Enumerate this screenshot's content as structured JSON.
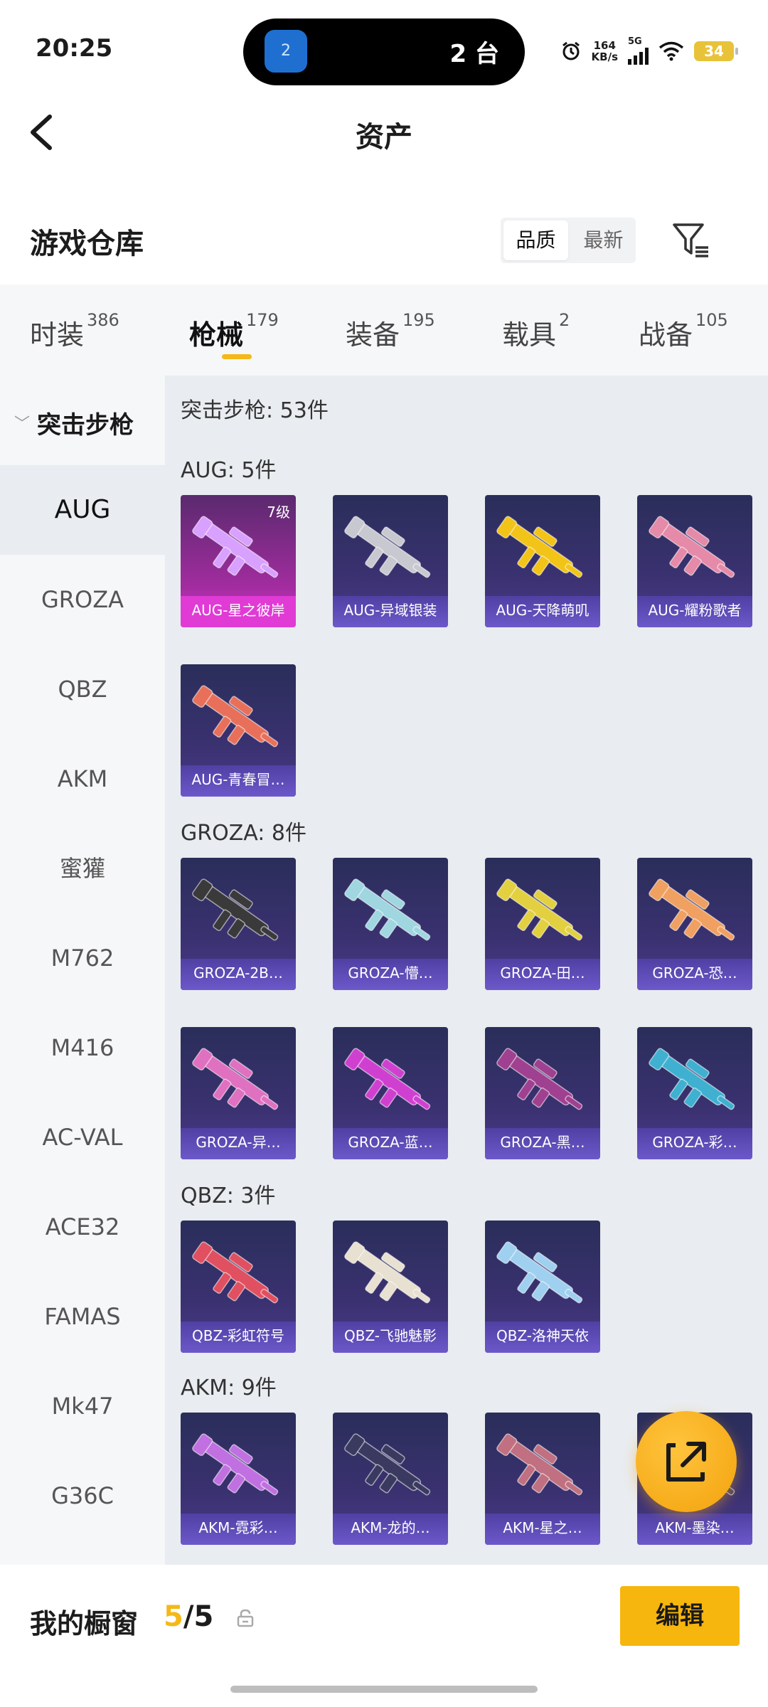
{
  "status_bar": {
    "time": "20:25",
    "island_badge": "2",
    "island_text": "2 台",
    "net_speed_value": "164",
    "net_speed_unit": "KB/s",
    "network": "5G",
    "battery": "34"
  },
  "header": {
    "title": "资产"
  },
  "warehouse": {
    "title": "游戏仓库",
    "sort_options": [
      "品质",
      "最新"
    ],
    "sort_selected": "品质"
  },
  "tabs": [
    {
      "label": "时装",
      "count": "386"
    },
    {
      "label": "枪械",
      "count": "179",
      "active": true
    },
    {
      "label": "装备",
      "count": "195"
    },
    {
      "label": "载具",
      "count": "2"
    },
    {
      "label": "战备",
      "count": "105"
    }
  ],
  "sidebar": {
    "group": "突击步枪",
    "items": [
      "AUG",
      "GROZA",
      "QBZ",
      "AKM",
      "蜜獾",
      "M762",
      "M416",
      "AC-VAL",
      "ACE32",
      "FAMAS",
      "Mk47",
      "G36C"
    ],
    "selected": "AUG"
  },
  "content": {
    "summary": "突击步枪: 53件",
    "sections": [
      {
        "title": "AUG: 5件",
        "items": [
          {
            "name": "AUG-星之彼岸",
            "level": "7级",
            "color": "#d8a0ff"
          },
          {
            "name": "AUG-异域银装",
            "color": "#c8c8d0"
          },
          {
            "name": "AUG-天降萌叽",
            "color": "#f2c418"
          },
          {
            "name": "AUG-耀粉歌者",
            "color": "#e58aa8"
          },
          {
            "name": "AUG-青春冒…",
            "color": "#e8705a"
          }
        ]
      },
      {
        "title": "GROZA: 8件",
        "items": [
          {
            "name": "GROZA-2B…",
            "color": "#3a3a3a"
          },
          {
            "name": "GROZA-懵…",
            "color": "#9fd6e0"
          },
          {
            "name": "GROZA-田…",
            "color": "#e2d040"
          },
          {
            "name": "GROZA-恐…",
            "color": "#f0a060"
          },
          {
            "name": "GROZA-异…",
            "color": "#e070c0"
          },
          {
            "name": "GROZA-蓝…",
            "color": "#d040d0"
          },
          {
            "name": "GROZA-黑…",
            "color": "#a04090"
          },
          {
            "name": "GROZA-彩…",
            "color": "#40b0d0"
          }
        ]
      },
      {
        "title": "QBZ: 3件",
        "items": [
          {
            "name": "QBZ-彩虹符号",
            "color": "#e05060"
          },
          {
            "name": "QBZ-飞驰魅影",
            "color": "#e8e0d0"
          },
          {
            "name": "QBZ-洛神天依",
            "color": "#a0d0f0"
          }
        ]
      },
      {
        "title": "AKM: 9件",
        "items": [
          {
            "name": "AKM-霓彩…",
            "color": "#c070e0"
          },
          {
            "name": "AKM-龙的…",
            "color": "#3a3a60"
          },
          {
            "name": "AKM-星之…",
            "color": "#c07080"
          },
          {
            "name": "AKM-墨染…",
            "color": "#404060"
          }
        ]
      }
    ]
  },
  "bottom": {
    "showcase_label": "我的橱窗",
    "showcase_current": "5",
    "showcase_total": "/5",
    "edit_label": "编辑"
  },
  "colors": {
    "accent": "#f5b818",
    "card_bg": "#3a3170",
    "card_label": "#6c58c9",
    "rare_card": "#e03bd5"
  },
  "icons": [
    "back-arrow-icon",
    "filter-icon",
    "share-icon",
    "lock-icon",
    "alarm-icon",
    "wifi-icon",
    "signal-icon"
  ]
}
